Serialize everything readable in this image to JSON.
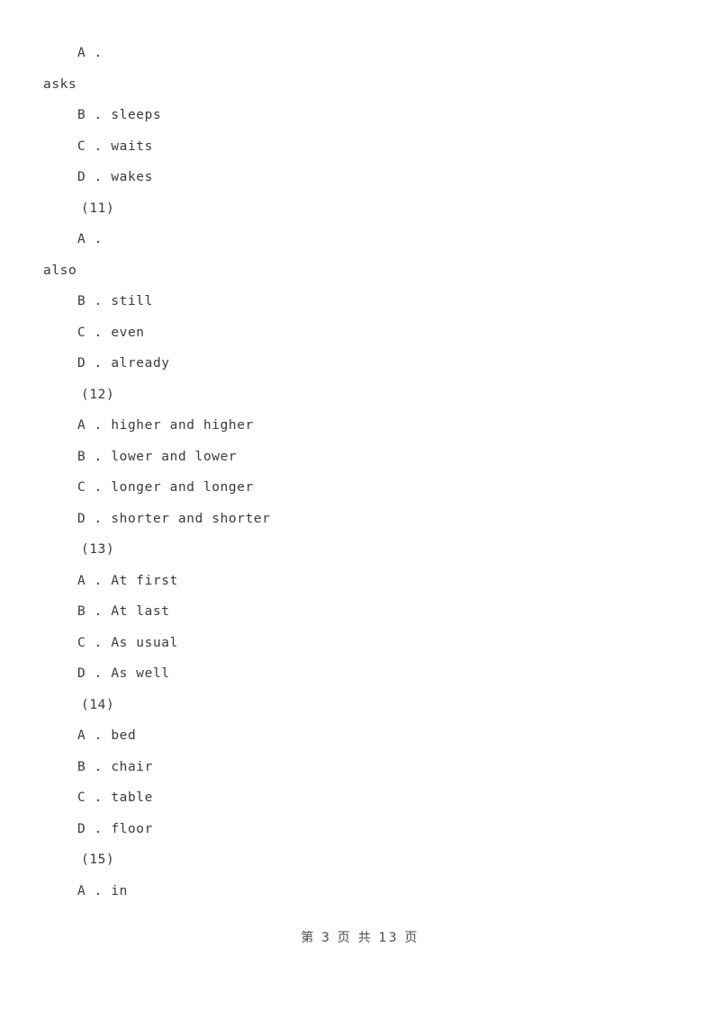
{
  "document": {
    "page_label": "第 3 页 共 13 页"
  },
  "lines": [
    {
      "id": "q10-opt-a",
      "style": "opt",
      "text": "A ."
    },
    {
      "id": "q10-opt-a-wrap",
      "style": "wrap",
      "text": "asks"
    },
    {
      "id": "q10-opt-b",
      "style": "opt",
      "text": "B . sleeps"
    },
    {
      "id": "q10-opt-c",
      "style": "opt",
      "text": "C . waits"
    },
    {
      "id": "q10-opt-d",
      "style": "opt",
      "text": "D . wakes"
    },
    {
      "id": "q11-number",
      "style": "qnum",
      "text": "(11)"
    },
    {
      "id": "q11-opt-a",
      "style": "opt",
      "text": "A ."
    },
    {
      "id": "q11-opt-a-wrap",
      "style": "wrap",
      "text": "also"
    },
    {
      "id": "q11-opt-b",
      "style": "opt",
      "text": "B . still"
    },
    {
      "id": "q11-opt-c",
      "style": "opt",
      "text": "C . even"
    },
    {
      "id": "q11-opt-d",
      "style": "opt",
      "text": "D . already"
    },
    {
      "id": "q12-number",
      "style": "qnum",
      "text": "(12)"
    },
    {
      "id": "q12-opt-a",
      "style": "opt",
      "text": "A . higher and higher"
    },
    {
      "id": "q12-opt-b",
      "style": "opt",
      "text": "B . lower and lower"
    },
    {
      "id": "q12-opt-c",
      "style": "opt",
      "text": "C . longer and longer"
    },
    {
      "id": "q12-opt-d",
      "style": "opt",
      "text": "D . shorter and shorter"
    },
    {
      "id": "q13-number",
      "style": "qnum",
      "text": "(13)"
    },
    {
      "id": "q13-opt-a",
      "style": "opt",
      "text": "A . At first"
    },
    {
      "id": "q13-opt-b",
      "style": "opt",
      "text": "B . At last"
    },
    {
      "id": "q13-opt-c",
      "style": "opt",
      "text": "C . As usual"
    },
    {
      "id": "q13-opt-d",
      "style": "opt",
      "text": "D . As well"
    },
    {
      "id": "q14-number",
      "style": "qnum",
      "text": "(14)"
    },
    {
      "id": "q14-opt-a",
      "style": "opt",
      "text": "A . bed"
    },
    {
      "id": "q14-opt-b",
      "style": "opt",
      "text": "B . chair"
    },
    {
      "id": "q14-opt-c",
      "style": "opt",
      "text": "C . table"
    },
    {
      "id": "q14-opt-d",
      "style": "opt",
      "text": "D . floor"
    },
    {
      "id": "q15-number",
      "style": "qnum",
      "text": "(15)"
    },
    {
      "id": "q15-opt-a",
      "style": "opt",
      "text": "A . in"
    }
  ]
}
